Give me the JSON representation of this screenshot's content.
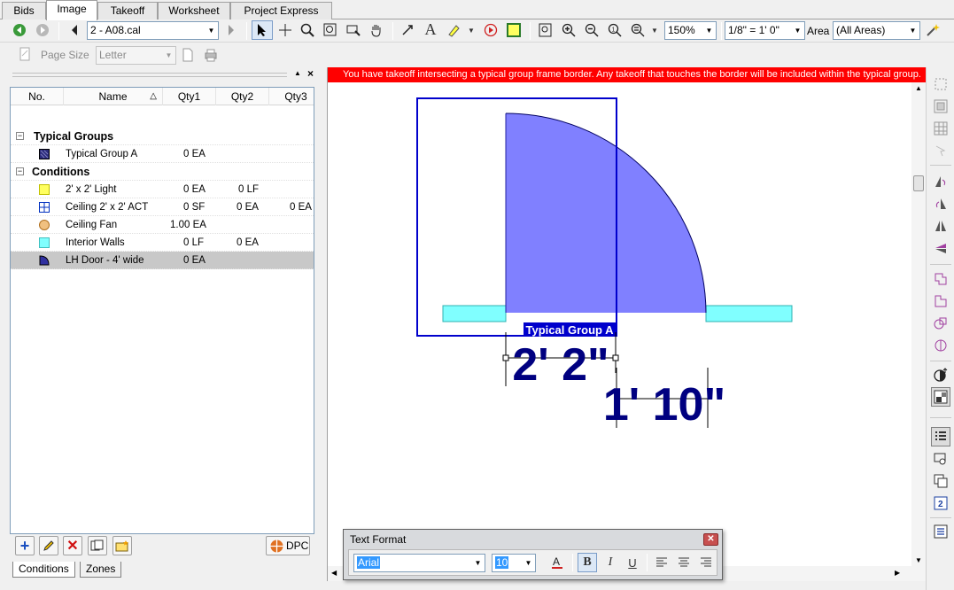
{
  "tabs": [
    {
      "label": "Bids",
      "active": false
    },
    {
      "label": "Image",
      "active": true
    },
    {
      "label": "Takeoff",
      "active": false
    },
    {
      "label": "Worksheet",
      "active": false
    },
    {
      "label": "Project Express",
      "active": false
    }
  ],
  "toolbar": {
    "page_select": "2 - A08.cal",
    "zoom": "150%",
    "scale": "1/8\" = 1' 0\"",
    "area_label": "Area",
    "area_select": "(All Areas)",
    "page_size_label": "Page Size",
    "page_size_select": "Letter"
  },
  "grid": {
    "columns": [
      "No.",
      "Name",
      "Qty1",
      "Qty2",
      "Qty3"
    ],
    "group_typical": "Typical Groups",
    "group_conditions": "Conditions",
    "rows": [
      {
        "name": "Typical Group A",
        "qty1": "0 EA",
        "qty2": "",
        "qty3": "",
        "icon": "typical-group-icon"
      },
      {
        "name": "2' x 2' Light",
        "qty1": "0 EA",
        "qty2": "0 LF",
        "qty3": "",
        "icon": "light-icon"
      },
      {
        "name": "Ceiling 2' x 2' ACT",
        "qty1": "0 SF",
        "qty2": "0 EA",
        "qty3": "0 EA",
        "icon": "ceiling-grid-icon"
      },
      {
        "name": "Ceiling Fan",
        "qty1": "1.00 EA",
        "qty2": "",
        "qty3": "",
        "icon": "fan-icon"
      },
      {
        "name": "Interior  Walls",
        "qty1": "0 LF",
        "qty2": "0 EA",
        "qty3": "",
        "icon": "wall-icon"
      },
      {
        "name": "LH Door - 4' wide",
        "qty1": "0 EA",
        "qty2": "",
        "qty3": "",
        "icon": "door-icon"
      }
    ]
  },
  "bottom": {
    "dpc_label": "DPC",
    "tab_conditions": "Conditions",
    "tab_zones": "Zones"
  },
  "canvas": {
    "warning": "You have takeoff intersecting a typical group frame border.  Any takeoff that touches the border will be included within the typical group.",
    "group_label": "Typical Group A",
    "dim1": "2' 2\"",
    "dim2": "1' 10\"",
    "colors": {
      "door_fill": "#8080ff",
      "wall_fill": "#80ffff",
      "frame": "#0000cc",
      "dimension": "#000080"
    }
  },
  "text_format": {
    "title": "Text Format",
    "font": "Arial",
    "size": "10",
    "bold": "B",
    "italic": "I",
    "underline": "U"
  }
}
